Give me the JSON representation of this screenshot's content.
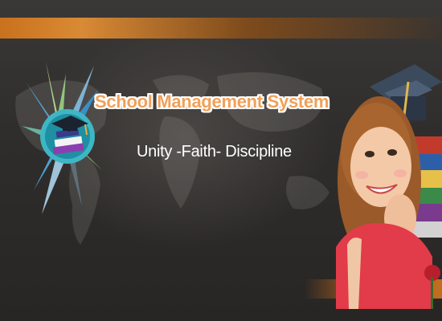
{
  "banner": {
    "title": "School Management System",
    "motto": "Unity -Faith- Discipline"
  },
  "colors": {
    "background": "#2e2c2a",
    "accent_orange": "#c8711e",
    "title_fill": "#f0a15a",
    "title_outline": "#ffffff",
    "motto_text": "#ffffff"
  },
  "icons": {
    "logo": "school-emblem-icon",
    "photo": "student-with-graduation-cap"
  }
}
